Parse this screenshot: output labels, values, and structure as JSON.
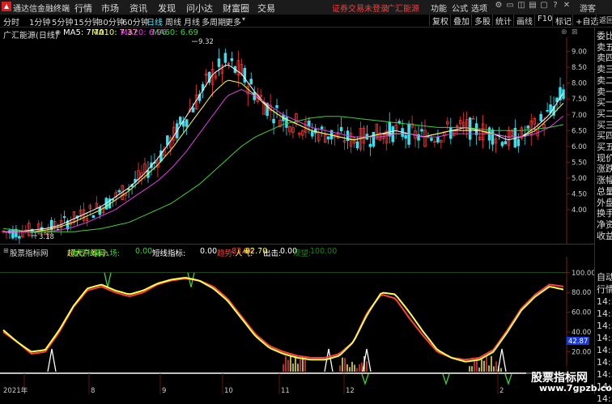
{
  "topbar": {
    "app_title": "通达信金融终端",
    "menus": [
      "行情",
      "市场",
      "资讯",
      "发现",
      "问小达",
      "财富圈",
      "交易"
    ],
    "login_text": "证券交易未登录",
    "account_text": "广汇能源",
    "right_menus": [
      "功能",
      "公式",
      "选项"
    ],
    "guest": "游客"
  },
  "toolbar": {
    "periods": [
      "分时",
      "1分钟",
      "5分钟",
      "15分钟",
      "30分钟",
      "60分钟",
      "日线",
      "周线",
      "月线",
      "多周期",
      "更多"
    ],
    "active_period": "日线",
    "buttons": [
      "复权",
      "叠加",
      "多股",
      "统计",
      "画线",
      "F10",
      "标记",
      "+自选",
      "返回"
    ]
  },
  "chart_header": {
    "stock": "广汇能源(日线)",
    "ma_items": [
      {
        "label": "MA5: 7.70",
        "color": "#ffffff"
      },
      {
        "label": "MA10: 7.37",
        "color": "#ffff4d"
      },
      {
        "label": "MA20: 6.96",
        "color": "#e040e0"
      },
      {
        "label": "MA60: 6.69",
        "color": "#40d040"
      }
    ]
  },
  "indicator_header": {
    "name": "股票指标网",
    "items": [
      {
        "label": "超大户筹码: ",
        "value": "",
        "color": "#ffff4d"
      },
      {
        "label": "发现私募入场: ",
        "value": "0.00",
        "color": "#40d040"
      },
      {
        "label": "短线指标: ",
        "value": "0.00",
        "color": "#ffffff"
      },
      {
        "label": "趋势: ",
        "value": "83.94",
        "color": "#ff4040"
      },
      {
        "label": "人气: ",
        "value": "82.70",
        "color": "#ffff4d"
      },
      {
        "label": "出击: ",
        "value": "0.00",
        "color": "#ffffff"
      },
      {
        "label": "观望: ",
        "value": "100.00",
        "color": "#208020"
      }
    ]
  },
  "right_panel": {
    "items": [
      "委比",
      "卖五",
      "卖四",
      "卖三",
      "卖二",
      "卖一",
      "买一",
      "买二",
      "买三",
      "买四",
      "买五",
      "现价",
      "涨跌",
      "涨幅",
      "总量",
      "外盘",
      "换手",
      "净资",
      "收益"
    ],
    "lower_items": [
      "自动",
      "行情",
      "14:5",
      "14:5",
      "14:5",
      "14:5",
      "14:5",
      "14:5",
      "14:5",
      "14:5",
      "14:5"
    ]
  },
  "chart_data": [
    {
      "type": "line",
      "title": "广汇能源(日线)",
      "y_ticks": [
        9.0,
        8.5,
        8.0,
        7.5,
        7.0,
        6.5,
        6.0,
        5.5,
        5.0,
        4.5,
        4.0
      ],
      "ylim": [
        3.0,
        9.4
      ],
      "annotations": [
        {
          "text": "9.32",
          "kind": "high"
        },
        {
          "text": "3.18",
          "kind": "low"
        }
      ],
      "series": [
        {
          "name": "MA5",
          "color": "#ffffff",
          "values": [
            3.3,
            3.3,
            3.35,
            3.4,
            3.5,
            3.7,
            3.9,
            4.1,
            4.4,
            4.7,
            5.1,
            5.6,
            6.2,
            6.9,
            7.6,
            8.3,
            8.6,
            8.3,
            7.7,
            7.2,
            6.9,
            6.7,
            6.5,
            6.4,
            6.3,
            6.2,
            6.3,
            6.4,
            6.5,
            6.4,
            6.3,
            6.4,
            6.5,
            6.6,
            6.5,
            6.4,
            6.2,
            6.3,
            6.6,
            7.0,
            7.7
          ]
        },
        {
          "name": "MA10",
          "color": "#ffff4d",
          "values": [
            3.3,
            3.3,
            3.3,
            3.35,
            3.45,
            3.6,
            3.8,
            4.0,
            4.3,
            4.6,
            5.0,
            5.4,
            5.9,
            6.5,
            7.1,
            7.7,
            8.1,
            8.0,
            7.6,
            7.2,
            6.9,
            6.7,
            6.5,
            6.4,
            6.3,
            6.2,
            6.3,
            6.4,
            6.4,
            6.4,
            6.3,
            6.4,
            6.5,
            6.5,
            6.5,
            6.4,
            6.3,
            6.3,
            6.5,
            6.9,
            7.37
          ]
        },
        {
          "name": "MA20",
          "color": "#e040e0",
          "values": [
            3.3,
            3.3,
            3.3,
            3.3,
            3.35,
            3.45,
            3.6,
            3.8,
            4.0,
            4.3,
            4.6,
            4.9,
            5.3,
            5.8,
            6.4,
            7.0,
            7.6,
            7.8,
            7.6,
            7.3,
            7.0,
            6.8,
            6.6,
            6.5,
            6.4,
            6.3,
            6.3,
            6.3,
            6.4,
            6.4,
            6.3,
            6.3,
            6.4,
            6.4,
            6.4,
            6.4,
            6.3,
            6.3,
            6.4,
            6.6,
            6.96
          ]
        },
        {
          "name": "MA60",
          "color": "#40d040",
          "values": [
            3.4,
            3.35,
            3.3,
            3.3,
            3.3,
            3.3,
            3.35,
            3.4,
            3.5,
            3.6,
            3.8,
            4.0,
            4.2,
            4.5,
            4.8,
            5.2,
            5.6,
            6.0,
            6.3,
            6.5,
            6.7,
            6.8,
            6.9,
            6.95,
            6.95,
            6.9,
            6.85,
            6.8,
            6.75,
            6.7,
            6.65,
            6.6,
            6.6,
            6.6,
            6.55,
            6.5,
            6.5,
            6.5,
            6.55,
            6.6,
            6.69
          ]
        }
      ]
    },
    {
      "type": "line",
      "title": "股票指标网",
      "y_ticks": [
        100.0,
        80.0,
        60.0,
        40.0,
        20.0
      ],
      "ylim": [
        0,
        108
      ],
      "current_value_label": "42.87",
      "x_ticks": [
        "2021年",
        "8",
        "9",
        "10",
        "11",
        "12",
        "2"
      ],
      "series": [
        {
          "name": "趋势",
          "color": "#ff4040",
          "values": [
            40,
            30,
            18,
            20,
            40,
            65,
            82,
            86,
            80,
            76,
            80,
            88,
            92,
            94,
            92,
            86,
            74,
            56,
            38,
            26,
            20,
            16,
            14,
            14,
            18,
            30,
            60,
            78,
            74,
            54,
            36,
            20,
            14,
            12,
            14,
            22,
            42,
            64,
            78,
            88,
            86
          ]
        },
        {
          "name": "人气",
          "color": "#ffff4d",
          "values": [
            42,
            30,
            20,
            22,
            42,
            66,
            84,
            88,
            82,
            78,
            82,
            89,
            93,
            95,
            92,
            84,
            72,
            54,
            36,
            24,
            18,
            14,
            12,
            12,
            16,
            30,
            58,
            80,
            78,
            60,
            40,
            22,
            14,
            10,
            12,
            20,
            40,
            62,
            76,
            86,
            83
          ]
        }
      ]
    }
  ]
}
